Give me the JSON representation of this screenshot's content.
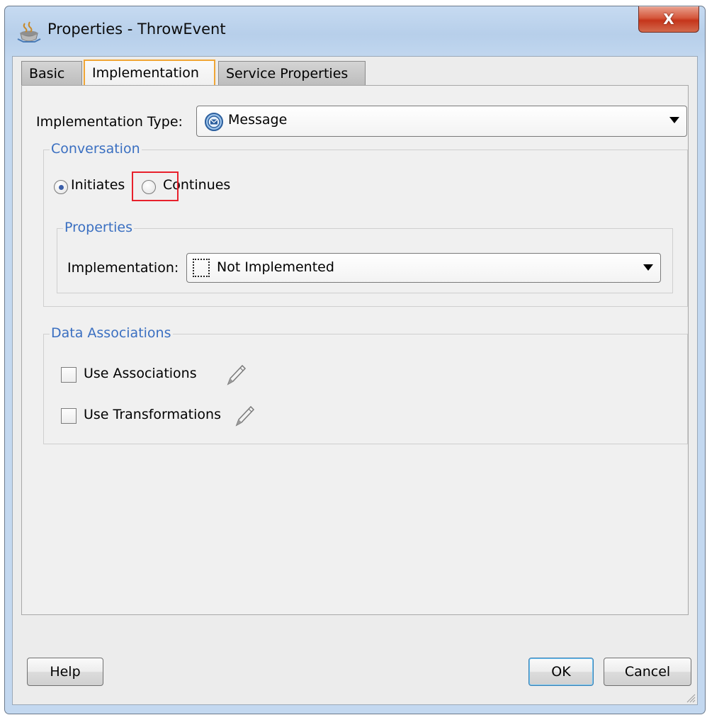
{
  "window": {
    "title": "Properties - ThrowEvent",
    "close_label": "X"
  },
  "tabs": [
    {
      "label": "Basic",
      "selected": false
    },
    {
      "label": "Implementation",
      "selected": true
    },
    {
      "label": "Service Properties",
      "selected": false
    }
  ],
  "implementation_type": {
    "label": "Implementation Type:",
    "value": "Message",
    "icon": "message-icon"
  },
  "conversation": {
    "title": "Conversation",
    "options": [
      {
        "label": "Initiates",
        "selected": true
      },
      {
        "label": "Continues",
        "selected": false
      }
    ],
    "properties": {
      "title": "Properties",
      "implementation_label": "Implementation:",
      "implementation_value": "Not Implemented",
      "icon": "not-implemented-icon"
    }
  },
  "data_associations": {
    "title": "Data Associations",
    "items": [
      {
        "label": "Use Associations",
        "checked": false,
        "icon": "pencil-icon"
      },
      {
        "label": "Use Transformations",
        "checked": false,
        "icon": "pencil-icon"
      }
    ]
  },
  "buttons": {
    "help": "Help",
    "ok": "OK",
    "cancel": "Cancel"
  },
  "colors": {
    "group_title": "#3a6fc1",
    "selected_tab_border": "#f0a636",
    "highlight": "#e8212c",
    "close_button": "#c5351b"
  }
}
